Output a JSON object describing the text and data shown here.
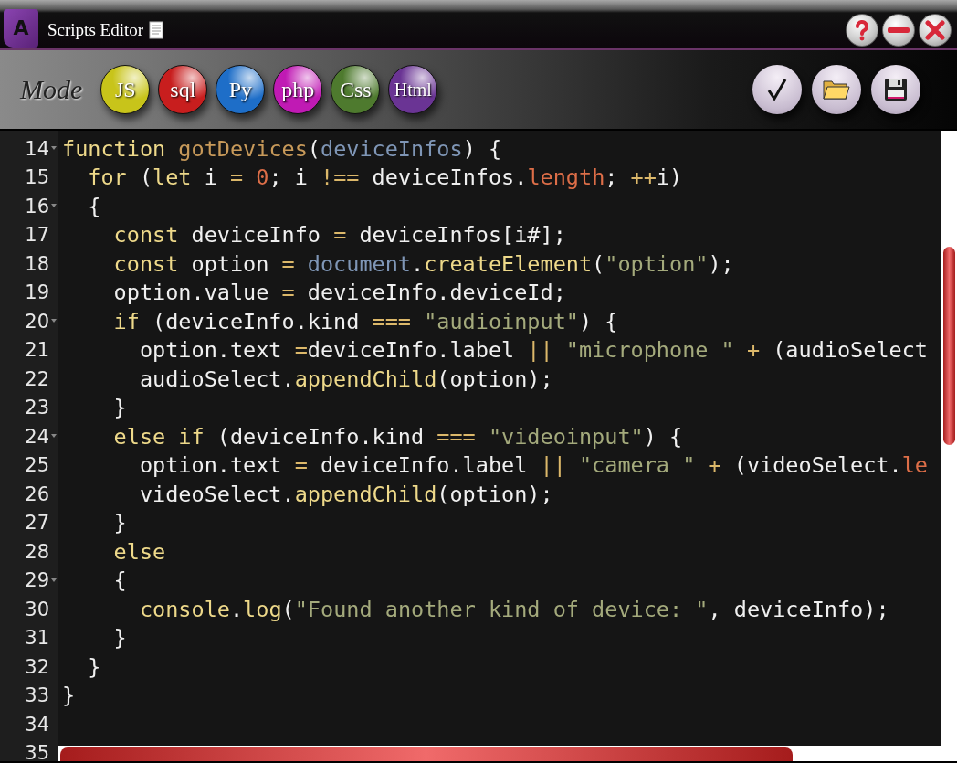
{
  "window": {
    "icon_letter": "A",
    "title": "Scripts Editor"
  },
  "toolbar": {
    "mode_label": "Mode",
    "modes": [
      {
        "label": "JS",
        "color": "#c8c41a"
      },
      {
        "label": "sql",
        "color": "#c81e1e"
      },
      {
        "label": "Py",
        "color": "#1e6ec8"
      },
      {
        "label": "php",
        "color": "#c01ab4"
      },
      {
        "label": "Css",
        "color": "#4e7a2e"
      },
      {
        "label": "Html",
        "color": "#6a3494"
      }
    ]
  },
  "editor": {
    "lines": [
      {
        "number": "14",
        "foldable": true,
        "tokens": [
          {
            "kind": "keyword",
            "text": "function "
          },
          {
            "kind": "function",
            "text": "gotDevices"
          },
          {
            "kind": "plain",
            "text": "("
          },
          {
            "kind": "param",
            "text": "deviceInfos"
          },
          {
            "kind": "plain",
            "text": ") {"
          }
        ]
      },
      {
        "number": "15",
        "foldable": false,
        "tokens": [
          {
            "kind": "keyword",
            "text": "  for"
          },
          {
            "kind": "plain",
            "text": " ("
          },
          {
            "kind": "keyword",
            "text": "let"
          },
          {
            "kind": "plain",
            "text": " i "
          },
          {
            "kind": "operator",
            "text": "= "
          },
          {
            "kind": "number",
            "text": "0"
          },
          {
            "kind": "plain",
            "text": "; i "
          },
          {
            "kind": "operator",
            "text": "!=="
          },
          {
            "kind": "plain",
            "text": " deviceInfos."
          },
          {
            "kind": "property",
            "text": "length"
          },
          {
            "kind": "plain",
            "text": "; "
          },
          {
            "kind": "operator",
            "text": "++"
          },
          {
            "kind": "plain",
            "text": "i)"
          }
        ]
      },
      {
        "number": "16",
        "foldable": true,
        "tokens": [
          {
            "kind": "plain",
            "text": "  {"
          }
        ]
      },
      {
        "number": "17",
        "foldable": false,
        "tokens": [
          {
            "kind": "keyword",
            "text": "    const"
          },
          {
            "kind": "plain",
            "text": " deviceInfo "
          },
          {
            "kind": "operator",
            "text": "="
          },
          {
            "kind": "plain",
            "text": " deviceInfos[i#];"
          }
        ]
      },
      {
        "number": "18",
        "foldable": false,
        "tokens": [
          {
            "kind": "keyword",
            "text": "    const"
          },
          {
            "kind": "plain",
            "text": " option "
          },
          {
            "kind": "operator",
            "text": "= "
          },
          {
            "kind": "param",
            "text": "document"
          },
          {
            "kind": "plain",
            "text": "."
          },
          {
            "kind": "method",
            "text": "createElement"
          },
          {
            "kind": "plain",
            "text": "("
          },
          {
            "kind": "string",
            "text": "\"option\""
          },
          {
            "kind": "plain",
            "text": ");"
          }
        ]
      },
      {
        "number": "19",
        "foldable": false,
        "tokens": [
          {
            "kind": "plain",
            "text": "    option.value "
          },
          {
            "kind": "operator",
            "text": "="
          },
          {
            "kind": "plain",
            "text": " deviceInfo.deviceId;"
          }
        ]
      },
      {
        "number": "20",
        "foldable": true,
        "tokens": [
          {
            "kind": "keyword",
            "text": "    if"
          },
          {
            "kind": "plain",
            "text": " (deviceInfo.kind "
          },
          {
            "kind": "operator",
            "text": "=== "
          },
          {
            "kind": "string",
            "text": "\"audioinput\""
          },
          {
            "kind": "plain",
            "text": ") {"
          }
        ]
      },
      {
        "number": "21",
        "foldable": false,
        "tokens": [
          {
            "kind": "plain",
            "text": "      option.text "
          },
          {
            "kind": "operator",
            "text": "="
          },
          {
            "kind": "plain",
            "text": "deviceInfo.label "
          },
          {
            "kind": "operator",
            "text": "|| "
          },
          {
            "kind": "string",
            "text": "\"microphone \" "
          },
          {
            "kind": "operator",
            "text": "+"
          },
          {
            "kind": "plain",
            "text": " (audioSelect"
          }
        ]
      },
      {
        "number": "22",
        "foldable": false,
        "tokens": [
          {
            "kind": "plain",
            "text": "      audioSelect."
          },
          {
            "kind": "method",
            "text": "appendChild"
          },
          {
            "kind": "plain",
            "text": "(option);"
          }
        ]
      },
      {
        "number": "23",
        "foldable": false,
        "tokens": [
          {
            "kind": "plain",
            "text": "    }"
          }
        ]
      },
      {
        "number": "24",
        "foldable": true,
        "tokens": [
          {
            "kind": "keyword",
            "text": "    else if"
          },
          {
            "kind": "plain",
            "text": " (deviceInfo.kind "
          },
          {
            "kind": "operator",
            "text": "=== "
          },
          {
            "kind": "string",
            "text": "\"videoinput\""
          },
          {
            "kind": "plain",
            "text": ") {"
          }
        ]
      },
      {
        "number": "25",
        "foldable": false,
        "tokens": [
          {
            "kind": "plain",
            "text": "      option.text "
          },
          {
            "kind": "operator",
            "text": "="
          },
          {
            "kind": "plain",
            "text": " deviceInfo.label "
          },
          {
            "kind": "operator",
            "text": "|| "
          },
          {
            "kind": "string",
            "text": "\"camera \" "
          },
          {
            "kind": "operator",
            "text": "+"
          },
          {
            "kind": "plain",
            "text": " (videoSelect."
          },
          {
            "kind": "property",
            "text": "le"
          }
        ]
      },
      {
        "number": "26",
        "foldable": false,
        "tokens": [
          {
            "kind": "plain",
            "text": "      videoSelect."
          },
          {
            "kind": "method",
            "text": "appendChild"
          },
          {
            "kind": "plain",
            "text": "(option);"
          }
        ]
      },
      {
        "number": "27",
        "foldable": false,
        "tokens": [
          {
            "kind": "plain",
            "text": "    }"
          }
        ]
      },
      {
        "number": "28",
        "foldable": false,
        "tokens": [
          {
            "kind": "keyword",
            "text": "    else"
          }
        ]
      },
      {
        "number": "29",
        "foldable": true,
        "tokens": [
          {
            "kind": "plain",
            "text": "    {"
          }
        ]
      },
      {
        "number": "30",
        "foldable": false,
        "tokens": [
          {
            "kind": "method",
            "text": "      console"
          },
          {
            "kind": "plain",
            "text": "."
          },
          {
            "kind": "method",
            "text": "log"
          },
          {
            "kind": "plain",
            "text": "("
          },
          {
            "kind": "string",
            "text": "\"Found another kind of device: \""
          },
          {
            "kind": "plain",
            "text": ", deviceInfo);"
          }
        ]
      },
      {
        "number": "31",
        "foldable": false,
        "tokens": [
          {
            "kind": "plain",
            "text": "    }"
          }
        ]
      },
      {
        "number": "32",
        "foldable": false,
        "tokens": [
          {
            "kind": "plain",
            "text": "  }"
          }
        ]
      },
      {
        "number": "33",
        "foldable": false,
        "tokens": [
          {
            "kind": "plain",
            "text": "}"
          }
        ]
      },
      {
        "number": "34",
        "foldable": false
      },
      {
        "number": "35",
        "foldable": false
      }
    ]
  }
}
